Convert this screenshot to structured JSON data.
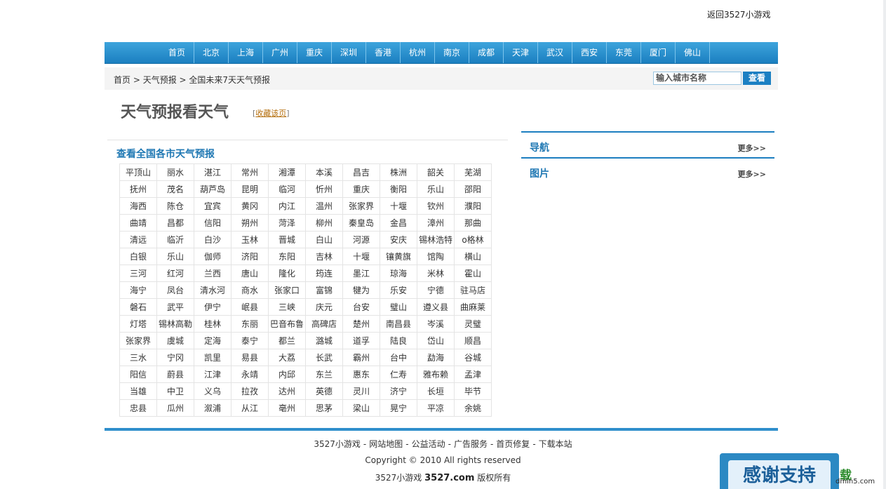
{
  "top_link": "返回3527小游戏",
  "nav": [
    "首页",
    "北京",
    "上海",
    "广州",
    "重庆",
    "深圳",
    "香港",
    "杭州",
    "南京",
    "成都",
    "天津",
    "武汉",
    "西安",
    "东莞",
    "厦门",
    "佛山"
  ],
  "breadcrumb": {
    "home": "首页",
    "sep1": " > ",
    "weather": "天气预报",
    "sep2": " > ",
    "current": "全国未来7天天气预报"
  },
  "search": {
    "placeholder": "输入城市名称",
    "button": "查看"
  },
  "page_title": "天气预报看天气",
  "bookmark": {
    "open": "[",
    "label": "收藏该页",
    "close": "]"
  },
  "section_title": "查看全国各市天气预报",
  "cities": [
    [
      "平顶山",
      "丽水",
      "湛江",
      "常州",
      "湘潭",
      "本溪",
      "昌吉",
      "株洲",
      "韶关",
      "芜湖"
    ],
    [
      "抚州",
      "茂名",
      "葫芦岛",
      "昆明",
      "临河",
      "忻州",
      "重庆",
      "衡阳",
      "乐山",
      "邵阳"
    ],
    [
      "海西",
      "陈仓",
      "宜宾",
      "黄冈",
      "内江",
      "温州",
      "张家界",
      "十堰",
      "钦州",
      "濮阳"
    ],
    [
      "曲靖",
      "昌都",
      "信阳",
      "朔州",
      "菏泽",
      "柳州",
      "秦皇岛",
      "金昌",
      "漳州",
      "那曲"
    ],
    [
      "清远",
      "临沂",
      "白沙",
      "玉林",
      "晋城",
      "白山",
      "河源",
      "安庆",
      "锡林浩特",
      "o格林"
    ],
    [
      "白银",
      "乐山",
      "伽师",
      "济阳",
      "东阳",
      "吉林",
      "十堰",
      "镶黄旗",
      "馆陶",
      "横山"
    ],
    [
      "三河",
      "红河",
      "兰西",
      "唐山",
      "隆化",
      "筠连",
      "墨江",
      "琼海",
      "米林",
      "霍山"
    ],
    [
      "海宁",
      "凤台",
      "清水河",
      "商水",
      "张家口",
      "富锦",
      "犍为",
      "乐安",
      "宁德",
      "驻马店"
    ],
    [
      "磐石",
      "武平",
      "伊宁",
      "岷县",
      "三峡",
      "庆元",
      "台安",
      "璧山",
      "遵义县",
      "曲麻莱"
    ],
    [
      "灯塔",
      "锡林高勒",
      "桂林",
      "东丽",
      "巴音布鲁",
      "高碑店",
      "楚州",
      "南昌县",
      "岑溪",
      "灵璧"
    ],
    [
      "张家界",
      "虞城",
      "定海",
      "泰宁",
      "都兰",
      "潞城",
      "道孚",
      "陆良",
      "岱山",
      "顺昌"
    ],
    [
      "三水",
      "宁冈",
      "凯里",
      "易县",
      "大荔",
      "长武",
      "霸州",
      "台中",
      "勐海",
      "谷城"
    ],
    [
      "阳信",
      "蔚县",
      "江津",
      "永靖",
      "内邱",
      "东兰",
      "惠东",
      "仁寿",
      "雅布赖",
      "孟津"
    ],
    [
      "当雄",
      "中卫",
      "义乌",
      "拉孜",
      "达州",
      "英德",
      "灵川",
      "济宁",
      "长垣",
      "毕节"
    ],
    [
      "忠县",
      "瓜州",
      "溆浦",
      "从江",
      "亳州",
      "思茅",
      "梁山",
      "晃宁",
      "平凉",
      "余姚"
    ]
  ],
  "panels": [
    {
      "title": "导航",
      "more": "更多>>"
    },
    {
      "title": "图片",
      "more": "更多>>"
    }
  ],
  "footer": {
    "links": [
      "3527小游戏",
      "网站地图",
      "公益活动",
      "广告服务",
      "首页修复",
      "下载本站"
    ],
    "separator": "-",
    "copyright": "Copyright © 2010 All rights reserved",
    "brand_prefix": "3527小游戏 ",
    "brand_domain": "3527.com",
    "brand_suffix": " 版权所有"
  },
  "badge": {
    "thanks": "感谢支持",
    "logo_char": "载",
    "site": "dmin5.com"
  }
}
